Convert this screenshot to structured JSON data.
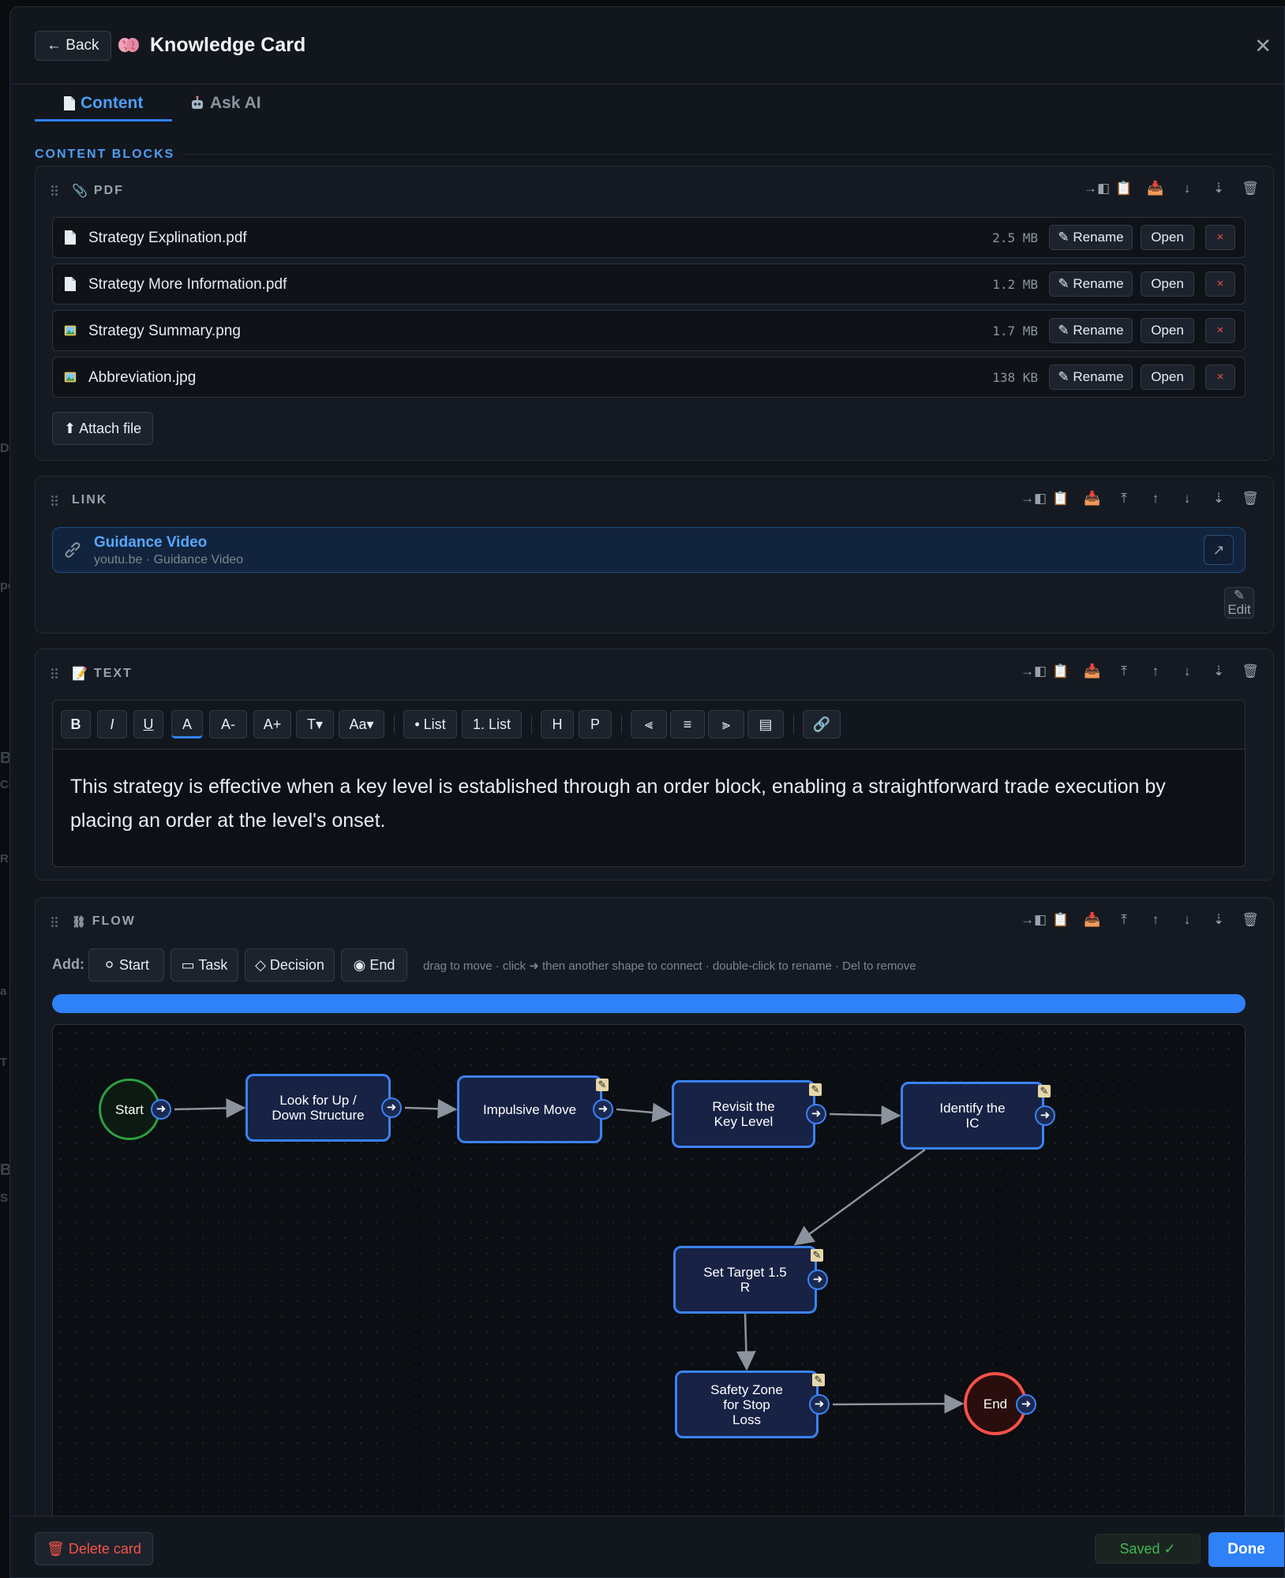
{
  "backdrop": {
    "hints": [
      "D",
      "pe",
      "Br",
      "Cc",
      "R",
      "a",
      "T",
      "Ba",
      "S"
    ]
  },
  "header": {
    "back_label": "← Back",
    "title": "Knowledge Card",
    "icon": "brain-icon",
    "close_label": "✕"
  },
  "tabs": [
    {
      "label": "Content",
      "icon": "document-icon",
      "active": true
    },
    {
      "label": "Ask AI",
      "icon": "robot-icon",
      "active": false
    }
  ],
  "section_label": "CONTENT BLOCKS",
  "pdf_block": {
    "type_label": "PDF",
    "tools": [
      "→◧",
      "📋",
      "📥",
      "↓",
      "⇣",
      "🗑"
    ],
    "files": [
      {
        "name": "Strategy Explination.pdf",
        "size": "2.5 MB",
        "kind": "document"
      },
      {
        "name": "Strategy More Information.pdf",
        "size": "1.2 MB",
        "kind": "document"
      },
      {
        "name": "Strategy Summary.png",
        "size": "1.7 MB",
        "kind": "image"
      },
      {
        "name": "Abbreviation.jpg",
        "size": "138 KB",
        "kind": "image"
      }
    ],
    "rename_label": "✎ Rename",
    "open_label": "Open",
    "delete_label": "×",
    "attach_label": "⬆ Attach file"
  },
  "link_block": {
    "type_label": "LINK",
    "tools": [
      "→◧",
      "📋",
      "📥",
      "⤒",
      "↑",
      "↓",
      "⇣",
      "🗑"
    ],
    "title": "Guidance Video",
    "subtitle": "youtu.be · Guidance Video",
    "open_icon": "↗",
    "edit_label": "Edit",
    "edit_icon": "✎"
  },
  "text_block": {
    "type_label": "TEXT",
    "tools": [
      "→◧",
      "📋",
      "📥",
      "⤒",
      "↑",
      "↓",
      "⇣",
      "🗑"
    ],
    "toolbar": [
      "B",
      "I",
      "U",
      "A",
      "A-",
      "A+",
      "T▾",
      "Aa▾",
      "• List",
      "1. List",
      "H",
      "P",
      "⫷",
      "≡",
      "⫸",
      "▤",
      "🔗"
    ],
    "content": "This strategy is effective when a key level is established through an order block, enabling a straightforward trade execution by placing an order at the level's onset."
  },
  "flow_block": {
    "type_label": "FLOW",
    "tools": [
      "→◧",
      "📋",
      "📥",
      "⤒",
      "↑",
      "↓",
      "⇣",
      "🗑"
    ],
    "add_label": "Add:",
    "add_buttons": [
      "⚪ Start",
      "▭ Task",
      "◇ Decision",
      "◉ End"
    ],
    "hint": "drag to move · click ➜ then another shape to connect · double-click to rename · Del to remove",
    "progress": 1.0,
    "accent": "#3b82f6",
    "nodes": [
      {
        "id": "start",
        "label": "Start",
        "kind": "start"
      },
      {
        "id": "n1",
        "label": "Look for Up / Down Structure",
        "kind": "task"
      },
      {
        "id": "n2",
        "label": "Impulsive Move",
        "kind": "task"
      },
      {
        "id": "n3",
        "label": "Revisit the Key Level",
        "kind": "task"
      },
      {
        "id": "n4",
        "label": "Identify the IC",
        "kind": "task"
      },
      {
        "id": "n5",
        "label": "Set Target 1.5 R",
        "kind": "task"
      },
      {
        "id": "n6",
        "label": "Safety Zone for Stop Loss",
        "kind": "task"
      },
      {
        "id": "end",
        "label": "End",
        "kind": "end"
      }
    ],
    "edges": [
      [
        "start",
        "n1"
      ],
      [
        "n1",
        "n2"
      ],
      [
        "n2",
        "n3"
      ],
      [
        "n3",
        "n4"
      ],
      [
        "n4",
        "n5"
      ],
      [
        "n5",
        "n6"
      ],
      [
        "n6",
        "end"
      ]
    ]
  },
  "footer": {
    "delete_label": "🗑 Delete card",
    "saved_label": "Saved ✓",
    "done_label": "Done"
  }
}
